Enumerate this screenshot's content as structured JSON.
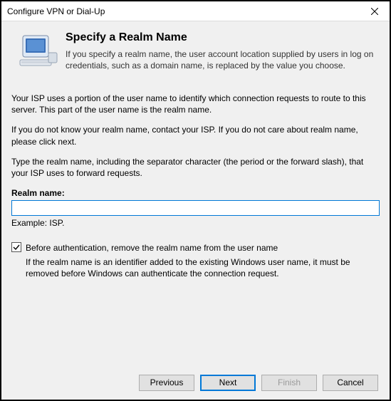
{
  "window": {
    "title": "Configure VPN or Dial-Up"
  },
  "header": {
    "title": "Specify a Realm Name",
    "subtitle": "If you specify a realm name, the user account location supplied by users in log on credentials, such as a domain name, is replaced by the value you choose."
  },
  "body": {
    "p1": "Your ISP uses a portion of the user name to identify which connection requests to route to this server. This part of the user name is the realm name.",
    "p2": "If you do not know your realm name, contact your ISP. If you do not care about realm name, please click next.",
    "p3": "Type the realm name, including the separator character (the period or the forward slash), that your ISP uses to forward requests.",
    "field_label": "Realm name:",
    "field_value": "",
    "example": "Example: ISP.",
    "checkbox_label": "Before authentication, remove the realm name from the user name",
    "checkbox_checked": true,
    "checkbox_desc": "If the realm name is an identifier added to the existing Windows user name, it must be removed before Windows can authenticate the connection request."
  },
  "footer": {
    "previous": "Previous",
    "next": "Next",
    "finish": "Finish",
    "cancel": "Cancel"
  }
}
